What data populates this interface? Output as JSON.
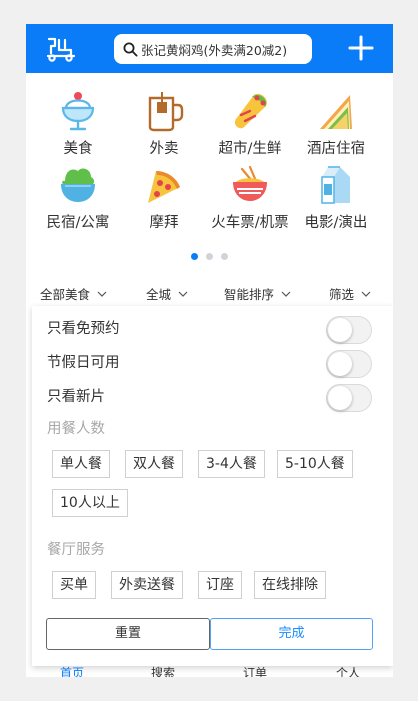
{
  "header": {
    "search_placeholder": "张记黄焖鸡(外卖满20减2)",
    "logo_icon": "scooter-logo-icon",
    "add_icon": "plus-icon",
    "bg_color": "#0a7cf7"
  },
  "categories": [
    {
      "label": "美食",
      "icon": "ice-cream-icon"
    },
    {
      "label": "外卖",
      "icon": "coffee-mug-icon"
    },
    {
      "label": "超市/生鲜",
      "icon": "burrito-icon"
    },
    {
      "label": "酒店住宿",
      "icon": "sandwich-icon"
    },
    {
      "label": "民宿/公寓",
      "icon": "salad-bowl-icon"
    },
    {
      "label": "摩拜",
      "icon": "pizza-icon"
    },
    {
      "label": "火车票/机票",
      "icon": "noodle-bowl-icon"
    },
    {
      "label": "电影/演出",
      "icon": "milk-carton-icon"
    }
  ],
  "pager": {
    "pages": 3,
    "active": 0
  },
  "filters": [
    "全部美食",
    "全城",
    "智能排序",
    "筛选"
  ],
  "panel": {
    "toggles": [
      {
        "label": "只看免预约",
        "on": false
      },
      {
        "label": "节假日可用",
        "on": false
      },
      {
        "label": "只看新片",
        "on": false
      }
    ],
    "diners_title": "用餐人数",
    "diners_options": [
      "单人餐",
      "双人餐",
      "3-4人餐",
      "5-10人餐",
      "10人以上"
    ],
    "service_title": "餐厅服务",
    "service_options": [
      "买单",
      "外卖送餐",
      "订座",
      "在线排除"
    ],
    "reset_label": "重置",
    "done_label": "完成"
  },
  "tabbar": [
    "首页",
    "搜索",
    "订单",
    "个人"
  ]
}
